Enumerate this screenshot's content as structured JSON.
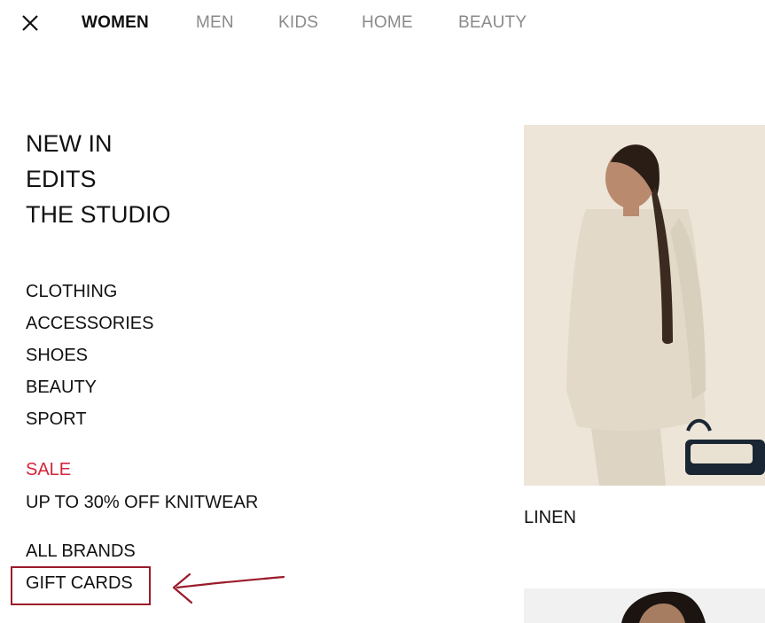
{
  "header": {
    "close_label": "Close menu",
    "tabs": [
      {
        "label": "WOMEN",
        "active": true
      },
      {
        "label": "MEN",
        "active": false
      },
      {
        "label": "KIDS",
        "active": false
      },
      {
        "label": "HOME",
        "active": false
      },
      {
        "label": "BEAUTY",
        "active": false
      }
    ]
  },
  "menu": {
    "primary": [
      "NEW IN",
      "EDITS",
      "THE STUDIO"
    ],
    "categories": [
      "CLOTHING",
      "ACCESSORIES",
      "SHOES",
      "BEAUTY",
      "SPORT"
    ],
    "sale": {
      "label": "SALE",
      "promo": "UP TO 30% OFF KNITWEAR"
    },
    "misc": [
      "ALL BRANDS",
      "GIFT CARDS"
    ]
  },
  "promo": {
    "caption": "LINEN"
  },
  "colors": {
    "sale": "#d4253a",
    "annotation": "#9b1b2a",
    "inactive_tab": "#8a8a8a"
  }
}
